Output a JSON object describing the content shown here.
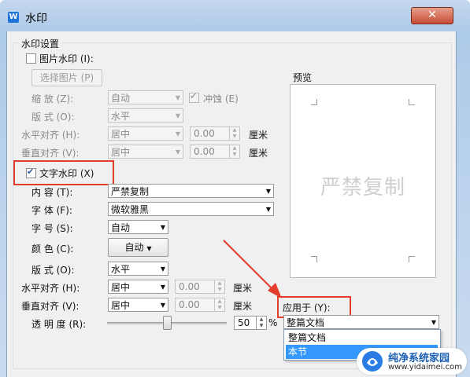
{
  "window": {
    "title": "水印",
    "close_glyph": "✕"
  },
  "group": {
    "title": "水印设置"
  },
  "picture": {
    "checkbox_label": "图片水印 (I):",
    "select_button": "选择图片 (P)",
    "scale_label": "缩 放 (Z):",
    "scale_value": "自动",
    "washout_label": "冲蚀 (E)",
    "layout_label": "版 式 (O):",
    "layout_value": "水平",
    "halign_label": "水平对齐 (H):",
    "halign_value": "居中",
    "halign_offset": "0.00",
    "valign_label": "垂直对齐 (V):",
    "valign_value": "居中",
    "valign_offset": "0.00",
    "unit": "厘米"
  },
  "preview": {
    "label": "预览",
    "watermark_text": "严禁复制"
  },
  "text": {
    "checkbox_label": "文字水印 (X)",
    "content_label": "内 容 (T):",
    "content_value": "严禁复制",
    "font_label": "字 体 (F):",
    "font_value": "微软雅黑",
    "size_label": "字 号 (S):",
    "size_value": "自动",
    "color_label": "颜 色 (C):",
    "color_value": "自动",
    "layout_label": "版 式 (O):",
    "layout_value": "水平",
    "halign_label": "水平对齐 (H):",
    "halign_value": "居中",
    "halign_offset": "0.00",
    "valign_label": "垂直对齐 (V):",
    "valign_value": "居中",
    "valign_offset": "0.00",
    "unit": "厘米",
    "transparency_label": "透 明 度 (R):",
    "transparency_value": "50",
    "transparency_unit": "%"
  },
  "apply": {
    "label": "应用于 (Y):",
    "selected": "整篇文档",
    "options": [
      "整篇文档",
      "本节"
    ]
  },
  "branding": {
    "name": "纯净系统家园",
    "url": "www.yidaimei.com"
  },
  "colors": {
    "highlight_red": "#e43c2d",
    "titlebar": "#aecbe9",
    "selection": "#3399ff"
  }
}
